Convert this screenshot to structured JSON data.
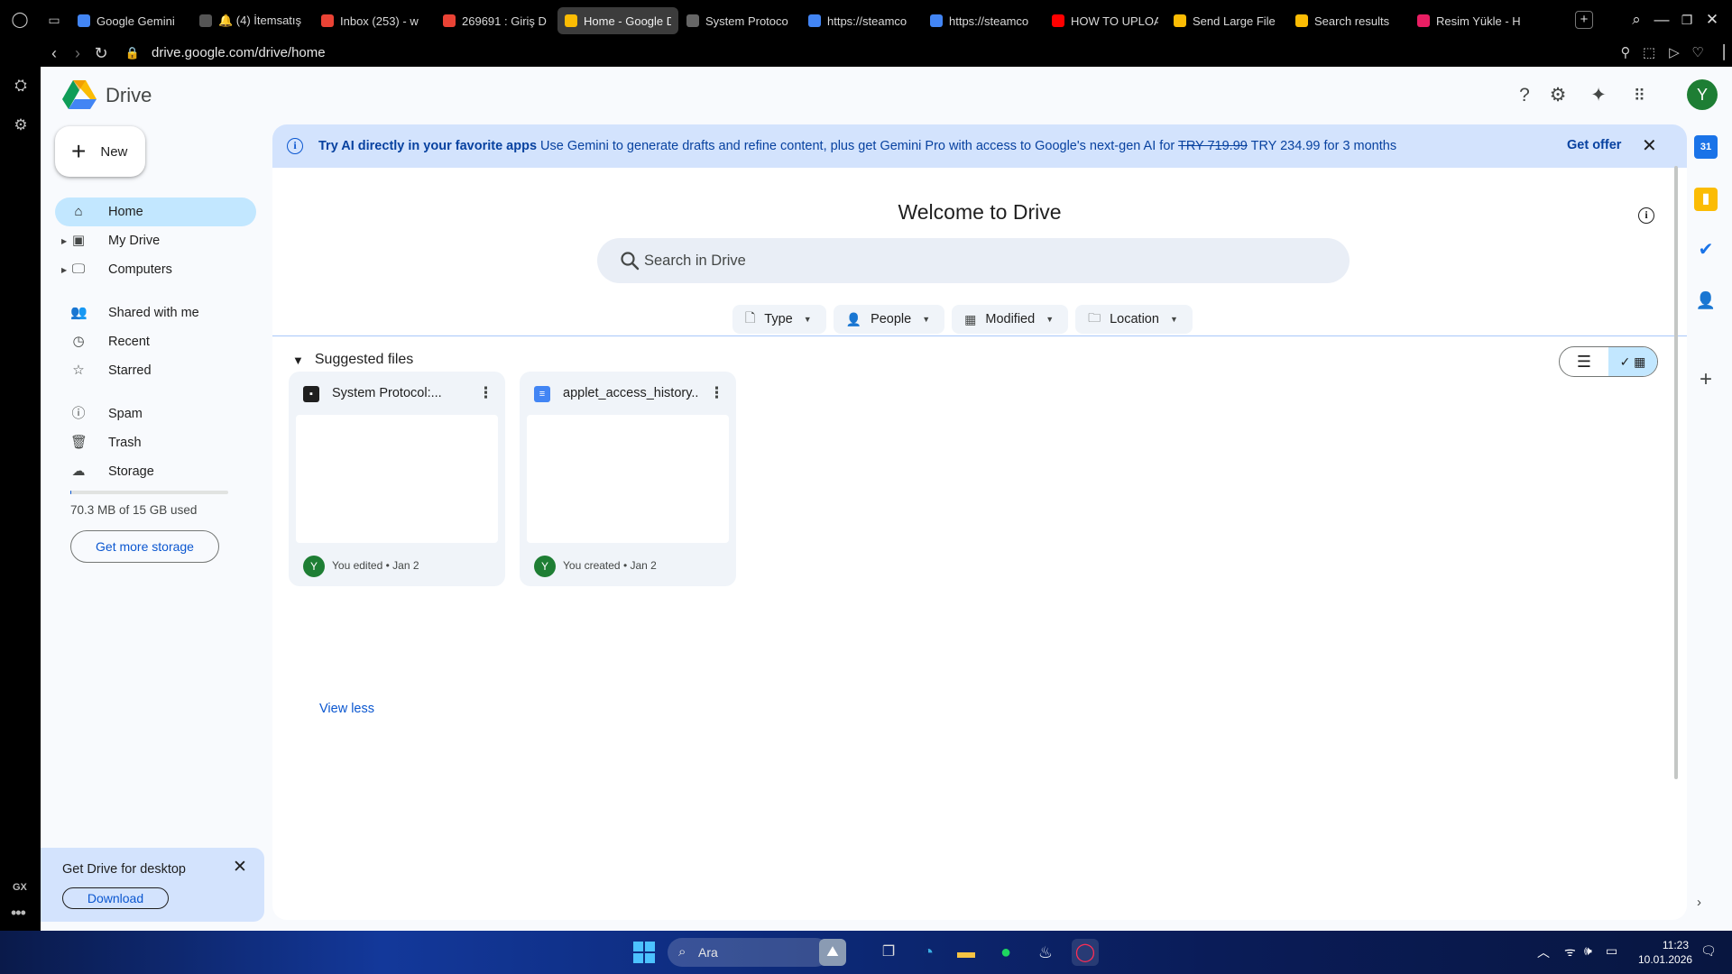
{
  "browser": {
    "tabs": [
      {
        "label": "Google Gemini",
        "favicon": "gemini-icon",
        "color": "#4285f4"
      },
      {
        "label": "🔔 (4) İtemsatış",
        "favicon": "itemsatis-icon",
        "color": "#555555"
      },
      {
        "label": "Inbox (253) - w",
        "favicon": "gmail-icon",
        "color": "#ea4335"
      },
      {
        "label": "269691 : Giriş D",
        "favicon": "gmail-icon",
        "color": "#ea4335"
      },
      {
        "label": "Home - Google Drive",
        "favicon": "drive-icon",
        "color": "#fbbc04",
        "active": true
      },
      {
        "label": "System Protoco",
        "favicon": "doc-icon",
        "color": "#666666"
      },
      {
        "label": "https://steamco",
        "favicon": "google-icon",
        "color": "#4285f4"
      },
      {
        "label": "https://steamco",
        "favicon": "google-icon",
        "color": "#4285f4"
      },
      {
        "label": "HOW TO UPLOA",
        "favicon": "youtube-icon",
        "color": "#ff0000"
      },
      {
        "label": "Send Large File",
        "favicon": "drive-icon",
        "color": "#fbbc04"
      },
      {
        "label": "Search results",
        "favicon": "drive-icon",
        "color": "#fbbc04"
      },
      {
        "label": "Resim Yükle - H",
        "favicon": "hash-icon",
        "color": "#e91e63"
      }
    ],
    "url": "drive.google.com/drive/home"
  },
  "drive": {
    "brand": "Drive",
    "account_initial": "Y",
    "new_label": "New",
    "nav": [
      {
        "label": "Home",
        "icon": "home-icon"
      },
      {
        "label": "My Drive",
        "icon": "my-drive-icon"
      },
      {
        "label": "Computers",
        "icon": "computers-icon"
      },
      {
        "label": "Shared with me",
        "icon": "shared-icon"
      },
      {
        "label": "Recent",
        "icon": "clock-icon"
      },
      {
        "label": "Starred",
        "icon": "star-icon"
      },
      {
        "label": "Spam",
        "icon": "spam-icon"
      },
      {
        "label": "Trash",
        "icon": "trash-icon"
      },
      {
        "label": "Storage",
        "icon": "cloud-icon"
      }
    ],
    "storage_used_fraction": 0.0047,
    "storage_text": "70.3 MB of 15 GB used",
    "get_storage": "Get more storage",
    "desktop_promo": {
      "title": "Get Drive for desktop",
      "button": "Download"
    },
    "banner": {
      "title": "Try AI directly in your favorite apps",
      "text_before": " Use Gemini to generate drafts and refine content, plus get Gemini Pro with access to Google's next-gen AI for ",
      "old_price": "TRY 719.99",
      "text_after": " TRY 234.99 for 3 months",
      "cta": "Get offer"
    },
    "welcome": "Welcome to Drive",
    "search_placeholder": "Search in Drive",
    "filters": [
      {
        "label": "Type",
        "icon": "file-icon"
      },
      {
        "label": "People",
        "icon": "person-icon"
      },
      {
        "label": "Modified",
        "icon": "calendar-icon"
      },
      {
        "label": "Location",
        "icon": "folder-icon"
      }
    ],
    "suggested_title": "Suggested files",
    "files": [
      {
        "name": "System Protocol:...",
        "type_icon": "system-file-icon",
        "type_color": "#1f1f1f",
        "meta": "You edited • Jan 2",
        "owner": "Y"
      },
      {
        "name": "applet_access_history...",
        "type_icon": "google-doc-icon",
        "type_color": "#4285f4",
        "meta": "You created • Jan 2",
        "owner": "Y"
      }
    ],
    "view_less": "View less"
  },
  "taskbar": {
    "search": "Ara",
    "time": "11:23",
    "date": "10.01.2026"
  }
}
